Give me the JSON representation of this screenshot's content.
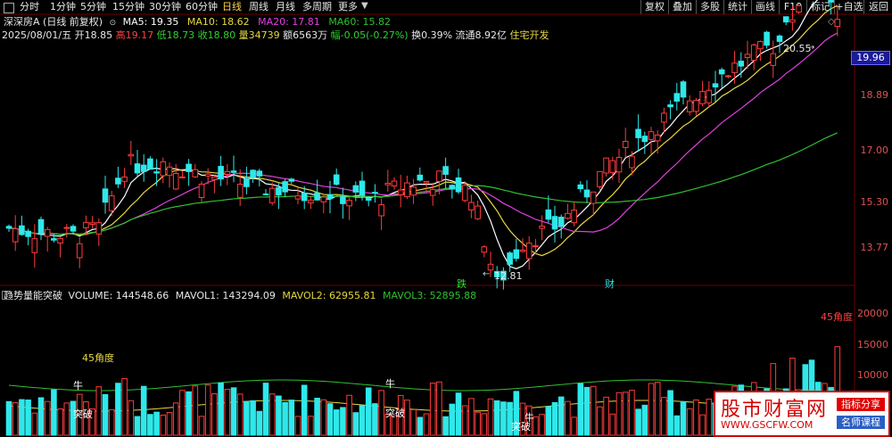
{
  "tabs": [
    {
      "label": "分时",
      "active": false
    },
    {
      "label": "1分钟",
      "active": false
    },
    {
      "label": "5分钟",
      "active": false
    },
    {
      "label": "15分钟",
      "active": false
    },
    {
      "label": "30分钟",
      "active": false
    },
    {
      "label": "60分钟",
      "active": false
    },
    {
      "label": "日线",
      "active": true
    },
    {
      "label": "周线",
      "active": false
    },
    {
      "label": "月线",
      "active": false
    },
    {
      "label": "多周期",
      "active": false
    },
    {
      "label": "更多",
      "active": false
    }
  ],
  "tools": [
    "复权",
    "叠加",
    "多股",
    "统计",
    "画线",
    "F10",
    "标记",
    "+自选",
    "返回"
  ],
  "ma_line": {
    "title": "深深房A (日线 前复权)",
    "ma5": "MA5: 19.35",
    "ma10": "MA10: 18.62",
    "ma20": "MA20: 17.81",
    "ma60": "MA60: 15.82"
  },
  "quote": {
    "date": "2025/08/01/五",
    "open": "开18.85",
    "high": "高19.17",
    "low": "低18.73",
    "close": "收18.80",
    "volume": "量34739",
    "amount": "额6563万",
    "change": "幅-0.05(-0.27%)",
    "turnover": "换0.39%",
    "float": "流通8.92亿",
    "sector": "住宅开发"
  },
  "price_axis": [
    "19.96",
    "18.89",
    "17.00",
    "15.30",
    "13.77"
  ],
  "current_price": "19.96",
  "annotations": {
    "high_mark": "20.55",
    "low_mark": "12.81",
    "signal_die": "跌",
    "signal_cai": "财"
  },
  "indicator": {
    "name": "趋势量能突破",
    "volume": "VOLUME: 144548.66",
    "mavol1": "MAVOL1: 143294.09",
    "mavol2": "MAVOL2: 62955.81",
    "mavol3": "MAVOL3: 52895.88"
  },
  "volume_axis": [
    "20000",
    "15000",
    "10000"
  ],
  "vol_marks": {
    "angle1": "45角度",
    "angle2": "45角度",
    "niu1": "牛",
    "niu2": "牛",
    "tupo1": "突破",
    "tupo2": "突破",
    "tupo3": "突破",
    "niu3": "牛"
  },
  "logo": {
    "title": "股市财富网",
    "url": "WWW.GSCFW.COM",
    "tag1": "指标分享",
    "tag2": "名师课程"
  },
  "colors": {
    "up": "#ff3b3b",
    "down": "#2ee8ea",
    "ma5": "#ffffff",
    "ma10": "#e8d840",
    "ma20": "#e040e0",
    "ma60": "#30c030"
  }
}
